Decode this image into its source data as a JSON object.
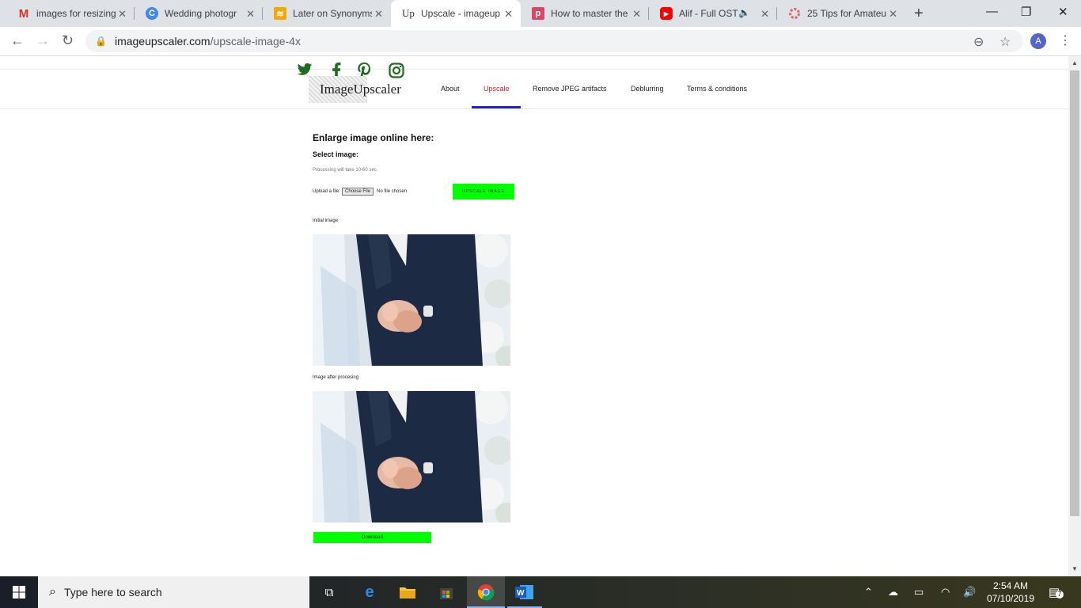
{
  "browser": {
    "tabs": [
      {
        "title": "images for resizing",
        "favicon": "gmail-icon",
        "color": "#d93025"
      },
      {
        "title": "Wedding photogr",
        "favicon": "c-icon",
        "color": "#4285f4"
      },
      {
        "title": "Later on Synonyms",
        "favicon": "thesaurus-icon",
        "color": "#f2a900"
      },
      {
        "title": "Upscale - imageup",
        "favicon": "up-icon",
        "color": "#333333"
      },
      {
        "title": "How to master the",
        "favicon": "p-icon",
        "color": "#e04565"
      },
      {
        "title": "Alif - Full OST",
        "favicon": "youtube-icon",
        "color": "#ff0000"
      },
      {
        "title": "25 Tips for Amateu",
        "favicon": "dots-icon",
        "color": "#e06666"
      }
    ],
    "url_host": "imageupscaler.com",
    "url_path": "/upscale-image-4x",
    "avatar": "A"
  },
  "site": {
    "logo_text": "ImageUpscaler",
    "nav": [
      "About",
      "Upscale",
      "Remove JPEG artifacts",
      "Deblurring",
      "Terms & conditions"
    ],
    "active_nav": "Upscale",
    "accent": "#00ff00",
    "active_color": "#e01a2a"
  },
  "main": {
    "heading": "Enlarge image online here:",
    "select_label": "Select image:",
    "note": "Processing will take 10-60 sec.",
    "upload_label": "Upload a file:",
    "choose_file": "Choose File",
    "no_file": "No file chosen",
    "upscale_button": "UPSCALE IMAGE",
    "initial_caption": "Initial image",
    "after_caption": "Image after procesing",
    "download_button": "Download"
  },
  "taskbar": {
    "search_placeholder": "Type here to search",
    "time": "2:54 AM",
    "date": "07/10/2019",
    "notification_count": "7"
  }
}
